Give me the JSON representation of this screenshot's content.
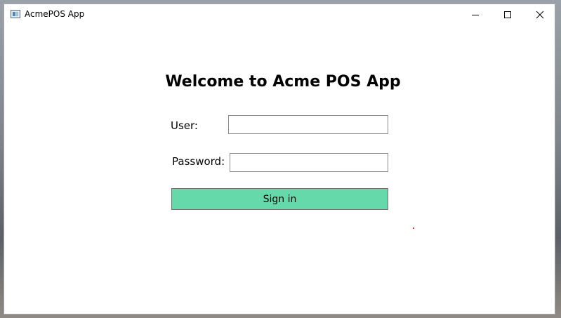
{
  "window": {
    "title": "AcmePOS App",
    "icon": "app-window-icon",
    "controls": {
      "minimize": "minimize-icon",
      "maximize": "maximize-icon",
      "close": "close-icon"
    }
  },
  "login": {
    "heading": "Welcome to Acme POS App",
    "user_label": "User:",
    "user_value": "",
    "password_label": "Password:",
    "password_value": "",
    "signin_label": "Sign in"
  },
  "colors": {
    "signin_button": "#66d9ab",
    "window_background": "#ffffff"
  }
}
